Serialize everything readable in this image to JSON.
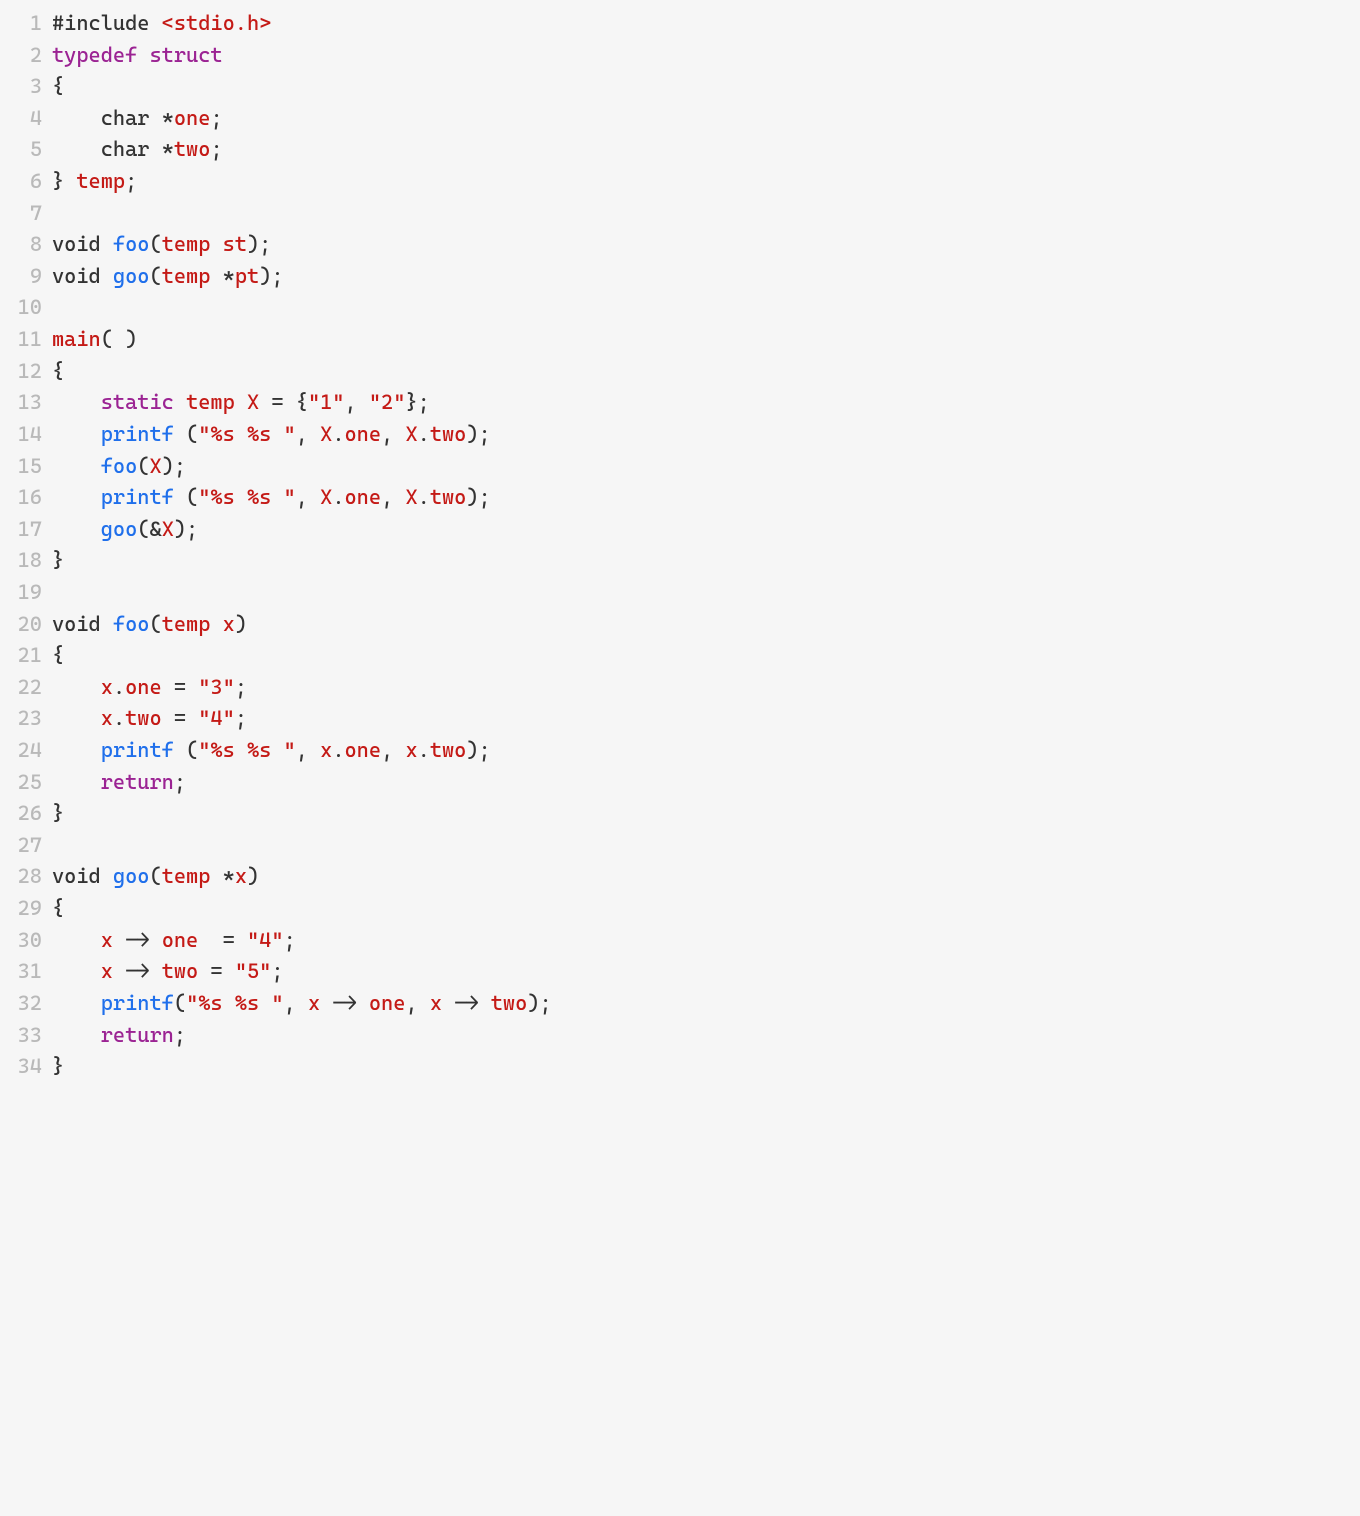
{
  "lines": [
    {
      "n": "1",
      "tokens": [
        {
          "c": "t-pre",
          "t": "#include "
        },
        {
          "c": "t-str",
          "t": "<stdio.h>"
        }
      ]
    },
    {
      "n": "2",
      "tokens": [
        {
          "c": "t-key",
          "t": "typedef"
        },
        {
          "c": "t-plain",
          "t": " "
        },
        {
          "c": "t-key",
          "t": "struct"
        }
      ]
    },
    {
      "n": "3",
      "tokens": [
        {
          "c": "t-punc",
          "t": "{"
        }
      ]
    },
    {
      "n": "4",
      "tokens": [
        {
          "c": "t-plain",
          "t": "    "
        },
        {
          "c": "t-plain",
          "t": "char "
        },
        {
          "c": "t-punc",
          "t": "*"
        },
        {
          "c": "t-member",
          "t": "one"
        },
        {
          "c": "t-punc",
          "t": ";"
        }
      ]
    },
    {
      "n": "5",
      "tokens": [
        {
          "c": "t-plain",
          "t": "    "
        },
        {
          "c": "t-plain",
          "t": "char "
        },
        {
          "c": "t-punc",
          "t": "*"
        },
        {
          "c": "t-member",
          "t": "two"
        },
        {
          "c": "t-punc",
          "t": ";"
        }
      ]
    },
    {
      "n": "6",
      "tokens": [
        {
          "c": "t-punc",
          "t": "} "
        },
        {
          "c": "t-type",
          "t": "temp"
        },
        {
          "c": "t-punc",
          "t": ";"
        }
      ]
    },
    {
      "n": "7",
      "tokens": [
        {
          "c": "t-plain",
          "t": ""
        }
      ]
    },
    {
      "n": "8",
      "tokens": [
        {
          "c": "t-plain",
          "t": "void "
        },
        {
          "c": "t-func",
          "t": "foo"
        },
        {
          "c": "t-punc",
          "t": "("
        },
        {
          "c": "t-type",
          "t": "temp"
        },
        {
          "c": "t-plain",
          "t": " "
        },
        {
          "c": "t-var",
          "t": "st"
        },
        {
          "c": "t-punc",
          "t": ");"
        }
      ]
    },
    {
      "n": "9",
      "tokens": [
        {
          "c": "t-plain",
          "t": "void "
        },
        {
          "c": "t-func",
          "t": "goo"
        },
        {
          "c": "t-punc",
          "t": "("
        },
        {
          "c": "t-type",
          "t": "temp"
        },
        {
          "c": "t-plain",
          "t": " "
        },
        {
          "c": "t-punc",
          "t": "*"
        },
        {
          "c": "t-var",
          "t": "pt"
        },
        {
          "c": "t-punc",
          "t": ");"
        }
      ]
    },
    {
      "n": "10",
      "tokens": [
        {
          "c": "t-plain",
          "t": ""
        }
      ]
    },
    {
      "n": "11",
      "tokens": [
        {
          "c": "t-type",
          "t": "main"
        },
        {
          "c": "t-punc",
          "t": "( )"
        }
      ]
    },
    {
      "n": "12",
      "tokens": [
        {
          "c": "t-punc",
          "t": "{"
        }
      ]
    },
    {
      "n": "13",
      "tokens": [
        {
          "c": "t-plain",
          "t": "    "
        },
        {
          "c": "t-key",
          "t": "static"
        },
        {
          "c": "t-plain",
          "t": " "
        },
        {
          "c": "t-type",
          "t": "temp"
        },
        {
          "c": "t-plain",
          "t": " "
        },
        {
          "c": "t-var",
          "t": "X"
        },
        {
          "c": "t-plain",
          "t": " = {"
        },
        {
          "c": "t-str",
          "t": "\"1\""
        },
        {
          "c": "t-punc",
          "t": ", "
        },
        {
          "c": "t-str",
          "t": "\"2\""
        },
        {
          "c": "t-punc",
          "t": "};"
        }
      ]
    },
    {
      "n": "14",
      "tokens": [
        {
          "c": "t-plain",
          "t": "    "
        },
        {
          "c": "t-func",
          "t": "printf"
        },
        {
          "c": "t-plain",
          "t": " ("
        },
        {
          "c": "t-str",
          "t": "\"%s %s \""
        },
        {
          "c": "t-punc",
          "t": ", "
        },
        {
          "c": "t-var",
          "t": "X"
        },
        {
          "c": "t-punc",
          "t": "."
        },
        {
          "c": "t-member",
          "t": "one"
        },
        {
          "c": "t-punc",
          "t": ", "
        },
        {
          "c": "t-var",
          "t": "X"
        },
        {
          "c": "t-punc",
          "t": "."
        },
        {
          "c": "t-member",
          "t": "two"
        },
        {
          "c": "t-punc",
          "t": ");"
        }
      ]
    },
    {
      "n": "15",
      "tokens": [
        {
          "c": "t-plain",
          "t": "    "
        },
        {
          "c": "t-func",
          "t": "foo"
        },
        {
          "c": "t-punc",
          "t": "("
        },
        {
          "c": "t-var",
          "t": "X"
        },
        {
          "c": "t-punc",
          "t": ");"
        }
      ]
    },
    {
      "n": "16",
      "tokens": [
        {
          "c": "t-plain",
          "t": "    "
        },
        {
          "c": "t-func",
          "t": "printf"
        },
        {
          "c": "t-plain",
          "t": " ("
        },
        {
          "c": "t-str",
          "t": "\"%s %s \""
        },
        {
          "c": "t-punc",
          "t": ", "
        },
        {
          "c": "t-var",
          "t": "X"
        },
        {
          "c": "t-punc",
          "t": "."
        },
        {
          "c": "t-member",
          "t": "one"
        },
        {
          "c": "t-punc",
          "t": ", "
        },
        {
          "c": "t-var",
          "t": "X"
        },
        {
          "c": "t-punc",
          "t": "."
        },
        {
          "c": "t-member",
          "t": "two"
        },
        {
          "c": "t-punc",
          "t": ");"
        }
      ]
    },
    {
      "n": "17",
      "tokens": [
        {
          "c": "t-plain",
          "t": "    "
        },
        {
          "c": "t-func",
          "t": "goo"
        },
        {
          "c": "t-punc",
          "t": "(&"
        },
        {
          "c": "t-var",
          "t": "X"
        },
        {
          "c": "t-punc",
          "t": ");"
        }
      ]
    },
    {
      "n": "18",
      "tokens": [
        {
          "c": "t-punc",
          "t": "}"
        }
      ]
    },
    {
      "n": "19",
      "tokens": [
        {
          "c": "t-plain",
          "t": ""
        }
      ]
    },
    {
      "n": "20",
      "tokens": [
        {
          "c": "t-plain",
          "t": "void "
        },
        {
          "c": "t-func",
          "t": "foo"
        },
        {
          "c": "t-punc",
          "t": "("
        },
        {
          "c": "t-type",
          "t": "temp"
        },
        {
          "c": "t-plain",
          "t": " "
        },
        {
          "c": "t-var",
          "t": "x"
        },
        {
          "c": "t-punc",
          "t": ")"
        }
      ]
    },
    {
      "n": "21",
      "tokens": [
        {
          "c": "t-punc",
          "t": "{"
        }
      ]
    },
    {
      "n": "22",
      "tokens": [
        {
          "c": "t-plain",
          "t": "    "
        },
        {
          "c": "t-var",
          "t": "x"
        },
        {
          "c": "t-punc",
          "t": "."
        },
        {
          "c": "t-member",
          "t": "one"
        },
        {
          "c": "t-plain",
          "t": " = "
        },
        {
          "c": "t-str",
          "t": "\"3\""
        },
        {
          "c": "t-punc",
          "t": ";"
        }
      ]
    },
    {
      "n": "23",
      "tokens": [
        {
          "c": "t-plain",
          "t": "    "
        },
        {
          "c": "t-var",
          "t": "x"
        },
        {
          "c": "t-punc",
          "t": "."
        },
        {
          "c": "t-member",
          "t": "two"
        },
        {
          "c": "t-plain",
          "t": " = "
        },
        {
          "c": "t-str",
          "t": "\"4\""
        },
        {
          "c": "t-punc",
          "t": ";"
        }
      ]
    },
    {
      "n": "24",
      "tokens": [
        {
          "c": "t-plain",
          "t": "    "
        },
        {
          "c": "t-func",
          "t": "printf"
        },
        {
          "c": "t-plain",
          "t": " ("
        },
        {
          "c": "t-str",
          "t": "\"%s %s \""
        },
        {
          "c": "t-punc",
          "t": ", "
        },
        {
          "c": "t-var",
          "t": "x"
        },
        {
          "c": "t-punc",
          "t": "."
        },
        {
          "c": "t-member",
          "t": "one"
        },
        {
          "c": "t-punc",
          "t": ", "
        },
        {
          "c": "t-var",
          "t": "x"
        },
        {
          "c": "t-punc",
          "t": "."
        },
        {
          "c": "t-member",
          "t": "two"
        },
        {
          "c": "t-punc",
          "t": ");"
        }
      ]
    },
    {
      "n": "25",
      "tokens": [
        {
          "c": "t-plain",
          "t": "    "
        },
        {
          "c": "t-key",
          "t": "return"
        },
        {
          "c": "t-punc",
          "t": ";"
        }
      ]
    },
    {
      "n": "26",
      "tokens": [
        {
          "c": "t-punc",
          "t": "}"
        }
      ]
    },
    {
      "n": "27",
      "tokens": [
        {
          "c": "t-plain",
          "t": ""
        }
      ]
    },
    {
      "n": "28",
      "tokens": [
        {
          "c": "t-plain",
          "t": "void "
        },
        {
          "c": "t-func",
          "t": "goo"
        },
        {
          "c": "t-punc",
          "t": "("
        },
        {
          "c": "t-type",
          "t": "temp"
        },
        {
          "c": "t-plain",
          "t": " "
        },
        {
          "c": "t-punc",
          "t": "*"
        },
        {
          "c": "t-var",
          "t": "x"
        },
        {
          "c": "t-punc",
          "t": ")"
        }
      ]
    },
    {
      "n": "29",
      "tokens": [
        {
          "c": "t-punc",
          "t": "{"
        }
      ]
    },
    {
      "n": "30",
      "tokens": [
        {
          "c": "t-plain",
          "t": "    "
        },
        {
          "c": "t-var",
          "t": "x"
        },
        {
          "c": "t-plain",
          "t": " -> "
        },
        {
          "c": "t-member",
          "t": "one"
        },
        {
          "c": "t-plain",
          "t": "  = "
        },
        {
          "c": "t-str",
          "t": "\"4\""
        },
        {
          "c": "t-punc",
          "t": ";"
        }
      ]
    },
    {
      "n": "31",
      "tokens": [
        {
          "c": "t-plain",
          "t": "    "
        },
        {
          "c": "t-var",
          "t": "x"
        },
        {
          "c": "t-plain",
          "t": " -> "
        },
        {
          "c": "t-member",
          "t": "two"
        },
        {
          "c": "t-plain",
          "t": " = "
        },
        {
          "c": "t-str",
          "t": "\"5\""
        },
        {
          "c": "t-punc",
          "t": ";"
        }
      ]
    },
    {
      "n": "32",
      "tokens": [
        {
          "c": "t-plain",
          "t": "    "
        },
        {
          "c": "t-func",
          "t": "printf"
        },
        {
          "c": "t-punc",
          "t": "("
        },
        {
          "c": "t-str",
          "t": "\"%s %s \""
        },
        {
          "c": "t-punc",
          "t": ", "
        },
        {
          "c": "t-var",
          "t": "x"
        },
        {
          "c": "t-plain",
          "t": " -> "
        },
        {
          "c": "t-member",
          "t": "one"
        },
        {
          "c": "t-punc",
          "t": ", "
        },
        {
          "c": "t-var",
          "t": "x"
        },
        {
          "c": "t-plain",
          "t": " -> "
        },
        {
          "c": "t-member",
          "t": "two"
        },
        {
          "c": "t-punc",
          "t": ");"
        }
      ]
    },
    {
      "n": "33",
      "tokens": [
        {
          "c": "t-plain",
          "t": "    "
        },
        {
          "c": "t-key",
          "t": "return"
        },
        {
          "c": "t-punc",
          "t": ";"
        }
      ]
    },
    {
      "n": "34",
      "tokens": [
        {
          "c": "t-punc",
          "t": "}"
        }
      ]
    }
  ]
}
